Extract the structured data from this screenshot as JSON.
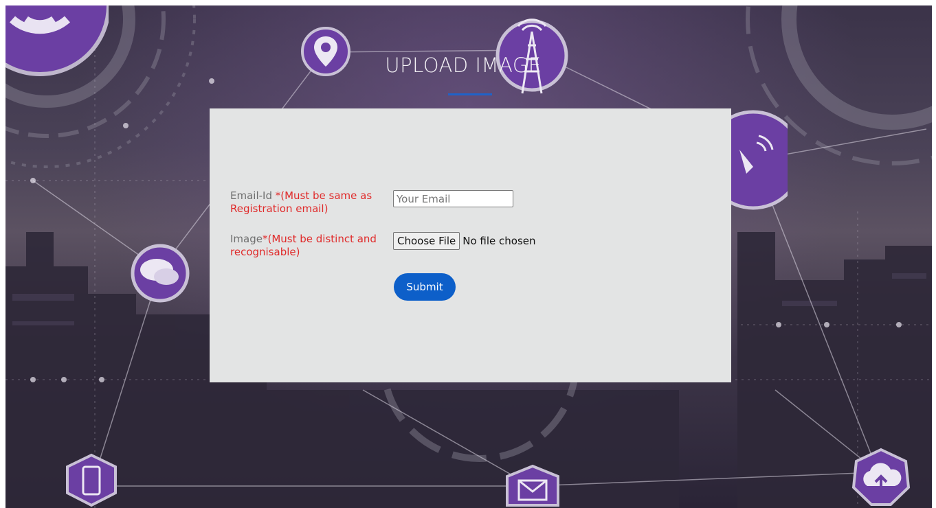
{
  "page": {
    "title": "UPLOAD IMAGE",
    "accent_color": "#1f63c9",
    "background_icons": [
      "wifi-icon",
      "location-pin-icon",
      "radio-tower-icon",
      "satellite-dish-icon",
      "chat-bubbles-icon",
      "mobile-phone-icon",
      "mail-icon",
      "cloud-upload-icon"
    ]
  },
  "form": {
    "email": {
      "label": "Email-Id ",
      "requirement": "*(Must be same as Registration email)",
      "placeholder": "Your Email",
      "value": ""
    },
    "image": {
      "label": "Image",
      "requirement": "*(Must be distinct and recognisable)",
      "button_label": "Choose File",
      "status": "No file chosen"
    },
    "submit_label": "Submit",
    "submit_color": "#0d5fc9",
    "card_color": "#e3e4e4",
    "required_color": "#e02a2a"
  }
}
